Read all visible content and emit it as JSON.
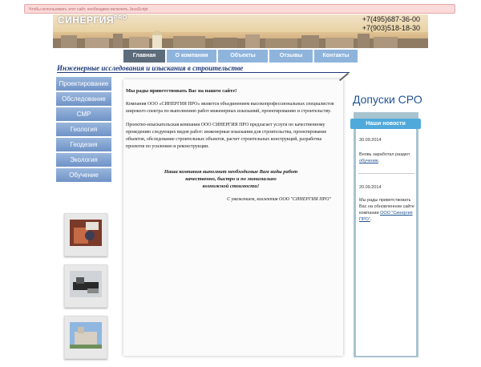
{
  "notice": "Чтобы использовать этот сайт, необходимо включить JavaScript",
  "header": {
    "logo": "СИНЕРГИЯ",
    "logo_sup": "PRO",
    "phone1": "+7(495)687-36-00",
    "phone2": "+7(903)518-18-30"
  },
  "nav": {
    "items": [
      "Главная",
      "О компании",
      "Объекты",
      "Отзывы",
      "Контакты"
    ]
  },
  "subtitle": "Инженерные исследования и изыскания в строительстве",
  "sidebar": {
    "items": [
      "Проектирование",
      "Обследование",
      "СМР",
      "Геология",
      "Геодезия",
      "Экология",
      "Обучение"
    ]
  },
  "main": {
    "welcome": "Мы рады приветствовать Вас на нашем сайте!",
    "p1": "Компания ООО «СИНЕРГИЯ ПРО» является объединением высокопрофессиональных специалистов широкого спектра по выполнению работ инженерных изысканий, проектированию и строительству.",
    "p2": "Проектно-изыскательская компания ООО СИНЕРГИЯ ПРО предлагает услуги по качественному проведению следующих видов работ: инженерные изыскания для строительства, проектирование объектов, обследование строительных объектов, расчет строительных конструкций, разработка проектов по усилению и реконструкции.",
    "slogan1": "Наша компания выполнит необходимые Вам виды работ",
    "slogan2": "качественно, быстро и по минимально",
    "slogan3": "возможной стоимости!",
    "signature": "С уважением, коллектив ООО \"СИНЕРГИЯ ПРО\""
  },
  "right": {
    "sro": "Допуски СРО",
    "news_title": "Наши новости",
    "news": [
      {
        "date": "30.09.2014",
        "text": "Вновь заработал раздел",
        "link": "обучение",
        "tail": "."
      },
      {
        "date": "20.09.2014",
        "text": "Мы рады приветствовать Вас на обновленном сайте компании",
        "link": "ООО \"Синергия ПРО\"",
        "tail": "."
      }
    ]
  },
  "colors": {
    "nav": "#8eb4dc",
    "nav_active": "#5d6c7b",
    "news_tab": "#4faadb",
    "title_blue": "#1f3a78"
  }
}
